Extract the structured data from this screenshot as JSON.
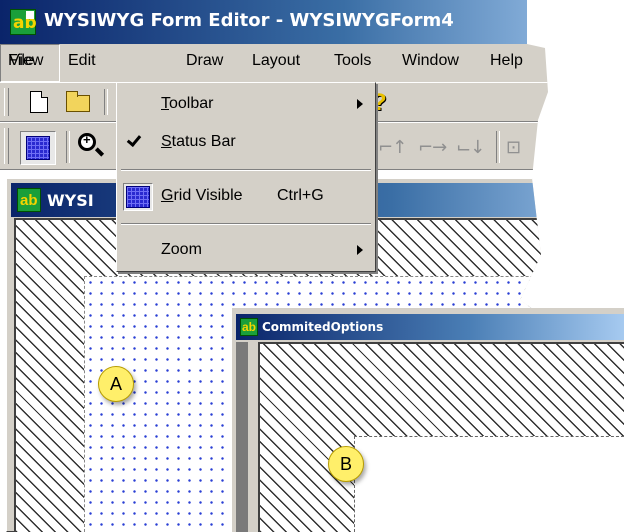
{
  "app": {
    "title": "WYSIWYG Form Editor - WYSIWYGForm4"
  },
  "menubar": {
    "items": [
      "File",
      "Edit",
      "View",
      "Draw",
      "Layout",
      "Tools",
      "Window",
      "Help"
    ]
  },
  "view_menu": {
    "toolbar": {
      "mnemonic": "T",
      "rest": "oolbar"
    },
    "status_bar": {
      "mnemonic": "S",
      "rest": "tatus Bar",
      "checked": true
    },
    "grid_visible": {
      "mnemonic": "G",
      "rest": "rid Visible",
      "shortcut": "Ctrl+G"
    },
    "zoom": {
      "label": "Zoom"
    }
  },
  "child_window_a": {
    "title": "WYSI"
  },
  "window_b": {
    "title": "CommitedOptions"
  },
  "callouts": {
    "a": "A",
    "b": "B"
  },
  "colors": {
    "titlebar_start": "#0a246a",
    "titlebar_end": "#a6caf0",
    "chrome": "#d4d0c8",
    "callout": "#ffef6a",
    "grid_dots": "#2a3fd4"
  },
  "icons": [
    "app-icon",
    "new-document-icon",
    "open-folder-icon",
    "help-icon",
    "grid-icon",
    "zoom-in-icon",
    "align-icons",
    "check-icon",
    "submenu-arrow-icon"
  ]
}
